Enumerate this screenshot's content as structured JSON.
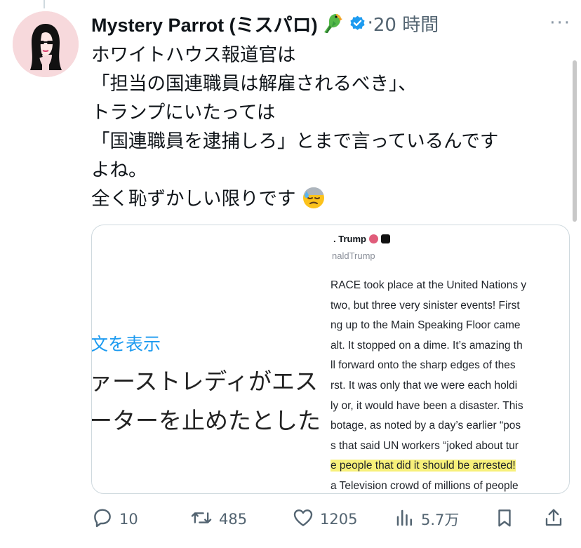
{
  "author": {
    "display_name": "Mystery Parrot (ミスパロ)",
    "name_emoji": "parrot-emoji",
    "verified": true,
    "separator": "·",
    "time": "20 時間",
    "more": "···"
  },
  "tweet": {
    "lines": [
      "ホワイトハウス報道官は",
      "「担当の国連職員は解雇されるべき」、",
      "トランプにいたっては",
      "「国連職員を逮捕しろ」とまで言っているんです",
      "よね。",
      "全く恥ずかしい限りです"
    ],
    "trailing_emoji": "downcast-sweat-face-emoji"
  },
  "media": {
    "show_original": "文を表示",
    "caption_lines": [
      "ァーストレディがエス",
      "ーターを止めたとした"
    ],
    "screenshot": {
      "name": ". Trump",
      "handle": "naldTrump",
      "lines": [
        "RACE took place at the United Nations y",
        "two, but three very sinister events! First",
        "ng up to the Main Speaking Floor came",
        "alt. It stopped on a dime. It’s amazing th",
        "ll forward onto the sharp edges of thes",
        "rst. It was only that we were each holdi",
        "ly or, it would have been a disaster. This",
        "botage, as noted by a day’s earlier “pos",
        "s that said UN workers “joked about tur",
        "e people that did it should be arrested!",
        "a Television crowd of millions of people"
      ],
      "highlighted_line_index": 9
    }
  },
  "actions": {
    "replies": "10",
    "reposts": "485",
    "likes": "1205",
    "views": "5.7万"
  },
  "colors": {
    "accent": "#1d9bf0",
    "muted": "#536471",
    "highlight": "#f7f07a"
  }
}
